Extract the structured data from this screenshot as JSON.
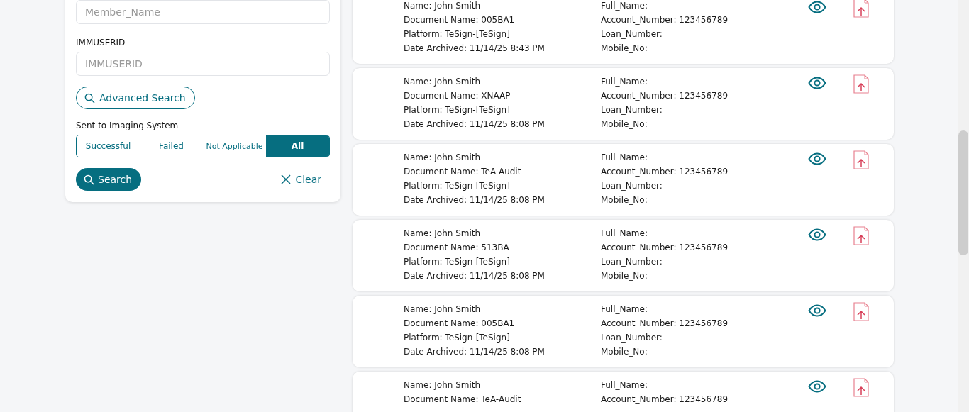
{
  "filters": {
    "member_name": {
      "placeholder": "Member_Name"
    },
    "immuserid": {
      "label": "IMMUSERID",
      "placeholder": "IMMUSERID"
    },
    "advanced_search": "Advanced Search",
    "sent_to_imaging": {
      "label": "Sent to Imaging System",
      "options": [
        {
          "label": "Successful",
          "selected": false
        },
        {
          "label": "Failed",
          "selected": false
        },
        {
          "label": "Not Applicable",
          "selected": false
        },
        {
          "label": "All",
          "selected": true
        }
      ]
    },
    "search": "Search",
    "clear": "Clear"
  },
  "results": [
    {
      "left": [
        "Name: John Smith",
        "Document Name: 005BA1",
        "Platform: TeSign-[TeSign]",
        "Date Archived: 11/14/25 8:43 PM"
      ],
      "right": [
        "Full_Name:",
        "Account_Number: 123456789",
        "Loan_Number:",
        "Mobile_No:"
      ]
    },
    {
      "left": [
        "Name: John Smith",
        "Document Name: XNAAP",
        "Platform: TeSign-[TeSign]",
        "Date Archived: 11/14/25 8:08 PM"
      ],
      "right": [
        "Full_Name:",
        "Account_Number: 123456789",
        "Loan_Number:",
        "Mobile_No:"
      ]
    },
    {
      "left": [
        "Name: John Smith",
        "Document Name: TeA-Audit",
        "Platform: TeSign-[TeSign]",
        "Date Archived: 11/14/25 8:08 PM"
      ],
      "right": [
        "Full_Name:",
        "Account_Number: 123456789",
        "Loan_Number:",
        "Mobile_No:"
      ]
    },
    {
      "left": [
        "Name: John Smith",
        "Document Name: 513BA",
        "Platform: TeSign-[TeSign]",
        "Date Archived: 11/14/25 8:08 PM"
      ],
      "right": [
        "Full_Name:",
        "Account_Number: 123456789",
        "Loan_Number:",
        "Mobile_No:"
      ]
    },
    {
      "left": [
        "Name: John Smith",
        "Document Name: 005BA1",
        "Platform: TeSign-[TeSign]",
        "Date Archived: 11/14/25 8:08 PM"
      ],
      "right": [
        "Full_Name:",
        "Account_Number: 123456789",
        "Loan_Number:",
        "Mobile_No:"
      ]
    },
    {
      "left": [
        "Name: John Smith",
        "Document Name: TeA-Audit"
      ],
      "right": [
        "Full_Name:",
        "Account_Number: 123456789"
      ]
    }
  ]
}
